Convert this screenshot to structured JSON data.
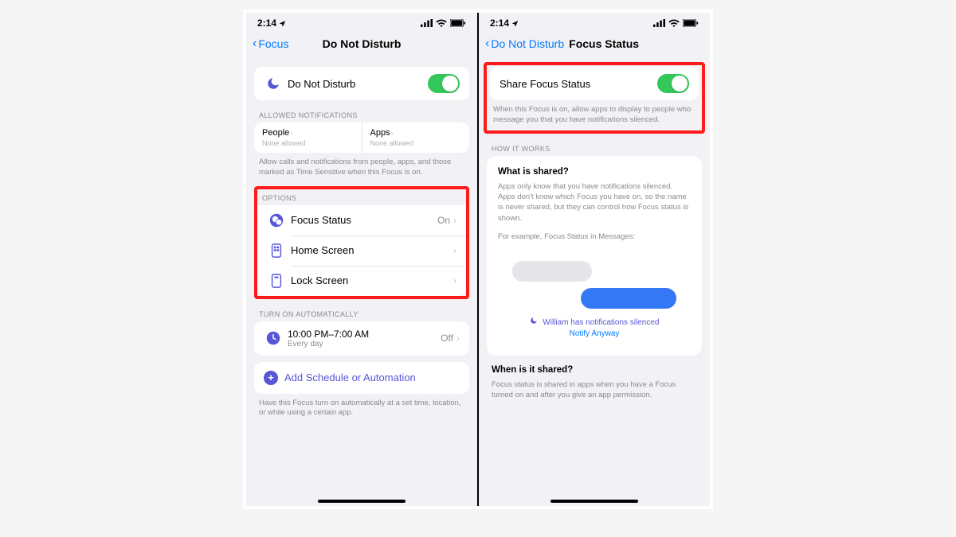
{
  "status": {
    "time": "2:14",
    "location_arrow": "➤"
  },
  "left": {
    "back": "Focus",
    "title": "Do Not Disturb",
    "main_toggle": {
      "label": "Do Not Disturb",
      "on": true
    },
    "allowed_header": "ALLOWED NOTIFICATIONS",
    "allowed": {
      "people": {
        "title": "People",
        "sub": "None allowed"
      },
      "apps": {
        "title": "Apps",
        "sub": "None allowed"
      }
    },
    "allowed_footer": "Allow calls and notifications from people, apps, and those marked as Time Sensitive when this Focus is on.",
    "options_header": "OPTIONS",
    "options": {
      "focus_status": {
        "label": "Focus Status",
        "value": "On"
      },
      "home_screen": {
        "label": "Home Screen"
      },
      "lock_screen": {
        "label": "Lock Screen"
      }
    },
    "auto_header": "TURN ON AUTOMATICALLY",
    "schedule": {
      "time": "10:00 PM–7:00 AM",
      "repeat": "Every day",
      "value": "Off"
    },
    "add_schedule": "Add Schedule or Automation",
    "auto_footer": "Have this Focus turn on automatically at a set time, location, or while using a certain app."
  },
  "right": {
    "back": "Do Not Disturb",
    "title": "Focus Status",
    "share_toggle": {
      "label": "Share Focus Status",
      "on": true
    },
    "share_footer": "When this Focus is on, allow apps to display to people who message you that you have notifications silenced.",
    "how_header": "HOW IT WORKS",
    "what_title": "What is shared?",
    "what_text": "Apps only know that you have notifications silenced. Apps don't know which Focus you have on, so the name is never shared, but they can control how Focus status is shown.",
    "example_line": "For example, Focus Status in Messages:",
    "msg_status": "William has notifications silenced",
    "notify_anyway": "Notify Anyway",
    "when_title": "When is it shared?",
    "when_text": "Focus status is shared in apps when you have a Focus turned on and after you give an app permission."
  }
}
